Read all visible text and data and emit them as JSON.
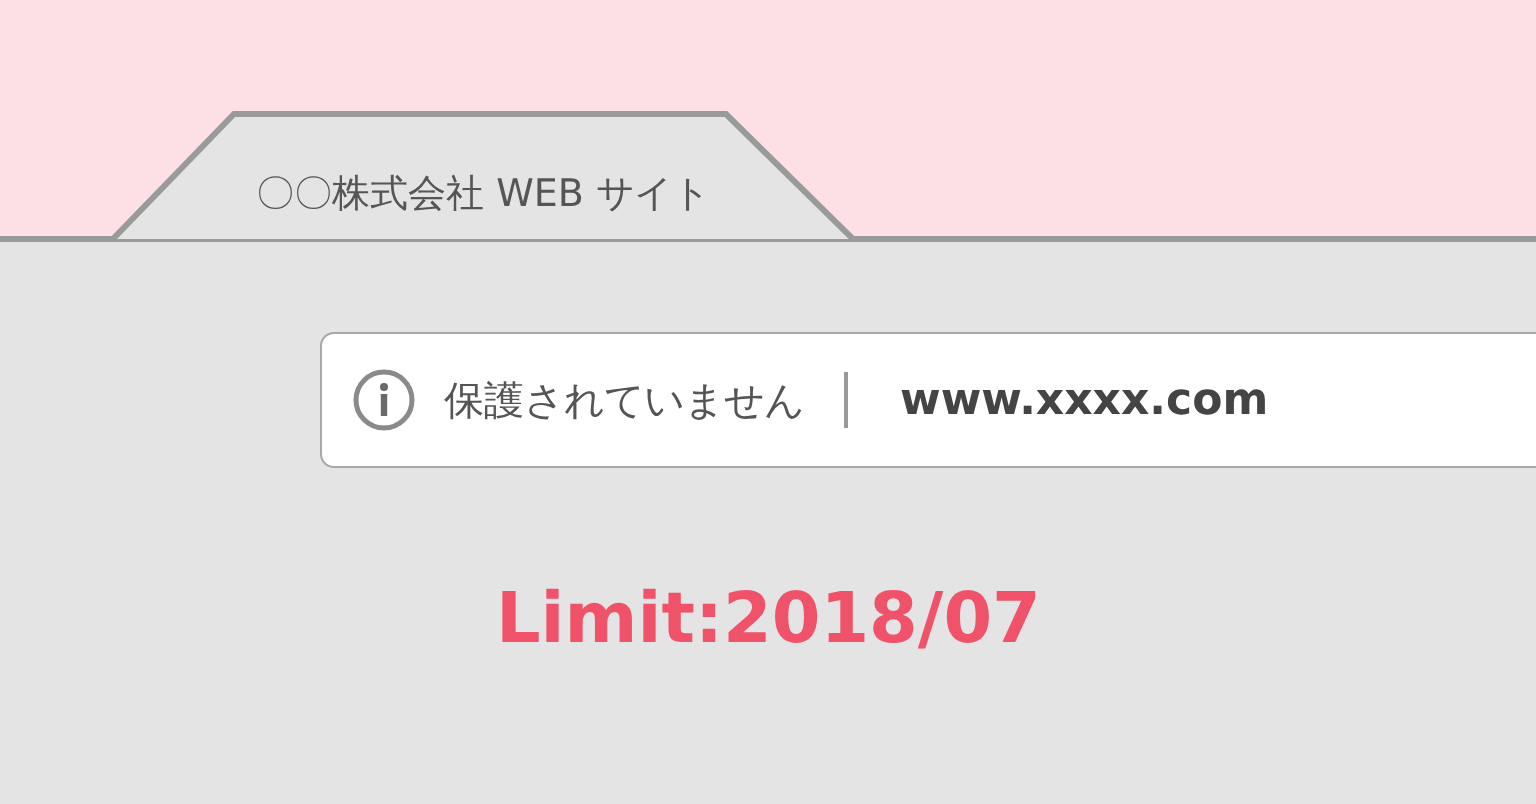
{
  "tab": {
    "title": "〇〇株式会社 WEB サイト"
  },
  "address_bar": {
    "security_status": "保護されていません",
    "url": "www.xxxx.com"
  },
  "limit_text": "Limit:2018/07"
}
